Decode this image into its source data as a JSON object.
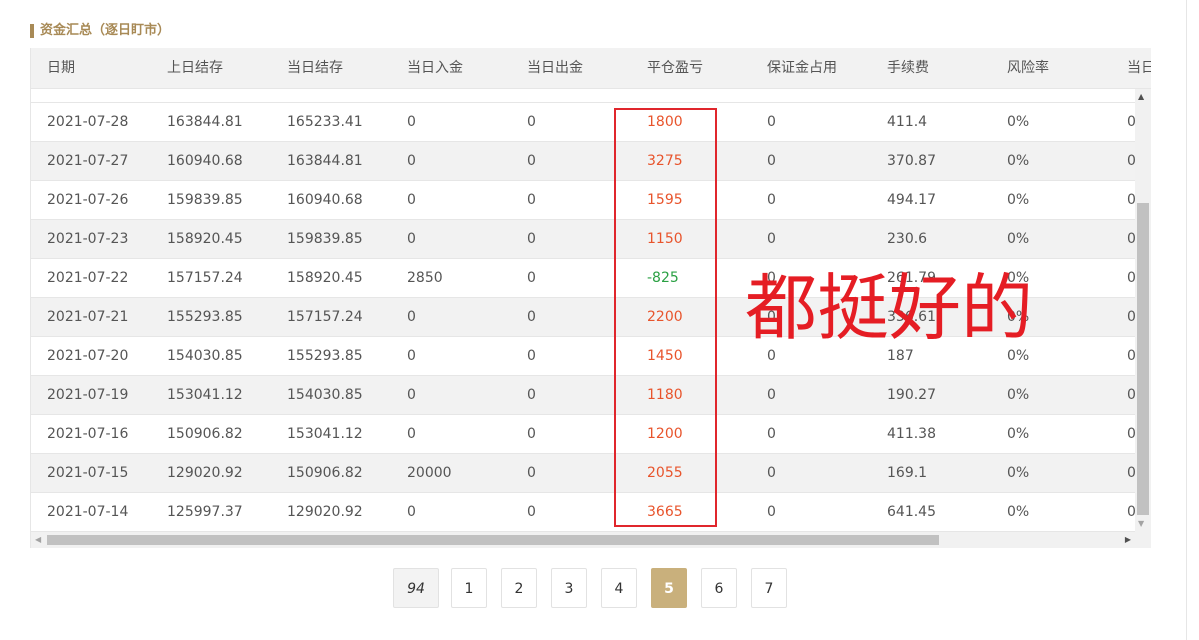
{
  "section": {
    "title": "资金汇总（逐日盯市）"
  },
  "table": {
    "columns": [
      "日期",
      "上日结存",
      "当日结存",
      "当日入金",
      "当日出金",
      "平仓盈亏",
      "保证金占用",
      "手续费",
      "风险率",
      "当日"
    ],
    "rows": [
      {
        "date": "2021-07-28",
        "prev": "163844.81",
        "curr": "165233.41",
        "dep": "0",
        "wd": "0",
        "pnl": "1800",
        "margin": "0",
        "fee": "411.4",
        "risk": "0%",
        "last": "0"
      },
      {
        "date": "2021-07-27",
        "prev": "160940.68",
        "curr": "163844.81",
        "dep": "0",
        "wd": "0",
        "pnl": "3275",
        "margin": "0",
        "fee": "370.87",
        "risk": "0%",
        "last": "0"
      },
      {
        "date": "2021-07-26",
        "prev": "159839.85",
        "curr": "160940.68",
        "dep": "0",
        "wd": "0",
        "pnl": "1595",
        "margin": "0",
        "fee": "494.17",
        "risk": "0%",
        "last": "0"
      },
      {
        "date": "2021-07-23",
        "prev": "158920.45",
        "curr": "159839.85",
        "dep": "0",
        "wd": "0",
        "pnl": "1150",
        "margin": "0",
        "fee": "230.6",
        "risk": "0%",
        "last": "0"
      },
      {
        "date": "2021-07-22",
        "prev": "157157.24",
        "curr": "158920.45",
        "dep": "2850",
        "wd": "0",
        "pnl": "-825",
        "margin": "0",
        "fee": "261.79",
        "risk": "0%",
        "last": "0"
      },
      {
        "date": "2021-07-21",
        "prev": "155293.85",
        "curr": "157157.24",
        "dep": "0",
        "wd": "0",
        "pnl": "2200",
        "margin": "0",
        "fee": "336.61",
        "risk": "0%",
        "last": "0"
      },
      {
        "date": "2021-07-20",
        "prev": "154030.85",
        "curr": "155293.85",
        "dep": "0",
        "wd": "0",
        "pnl": "1450",
        "margin": "0",
        "fee": "187",
        "risk": "0%",
        "last": "0"
      },
      {
        "date": "2021-07-19",
        "prev": "153041.12",
        "curr": "154030.85",
        "dep": "0",
        "wd": "0",
        "pnl": "1180",
        "margin": "0",
        "fee": "190.27",
        "risk": "0%",
        "last": "0"
      },
      {
        "date": "2021-07-16",
        "prev": "150906.82",
        "curr": "153041.12",
        "dep": "0",
        "wd": "0",
        "pnl": "1200",
        "margin": "0",
        "fee": "411.38",
        "risk": "0%",
        "last": "0"
      },
      {
        "date": "2021-07-15",
        "prev": "129020.92",
        "curr": "150906.82",
        "dep": "20000",
        "wd": "0",
        "pnl": "2055",
        "margin": "0",
        "fee": "169.1",
        "risk": "0%",
        "last": "0"
      },
      {
        "date": "2021-07-14",
        "prev": "125997.37",
        "curr": "129020.92",
        "dep": "0",
        "wd": "0",
        "pnl": "3665",
        "margin": "0",
        "fee": "641.45",
        "risk": "0%",
        "last": "0"
      }
    ]
  },
  "annotation": {
    "text": "都挺好的"
  },
  "pagination": {
    "total": "94",
    "pages": [
      "1",
      "2",
      "3",
      "4",
      "5",
      "6",
      "7"
    ],
    "current": "5"
  },
  "colors": {
    "accent": "#c9b07c",
    "title": "#a88a56",
    "profit": "#e8542c",
    "loss": "#2aa043",
    "annotation": "#e51d24"
  },
  "icons": {
    "scroll_up": "triangle-up-icon",
    "scroll_down": "triangle-down-icon",
    "scroll_left": "triangle-left-icon",
    "scroll_right": "triangle-right-icon"
  }
}
